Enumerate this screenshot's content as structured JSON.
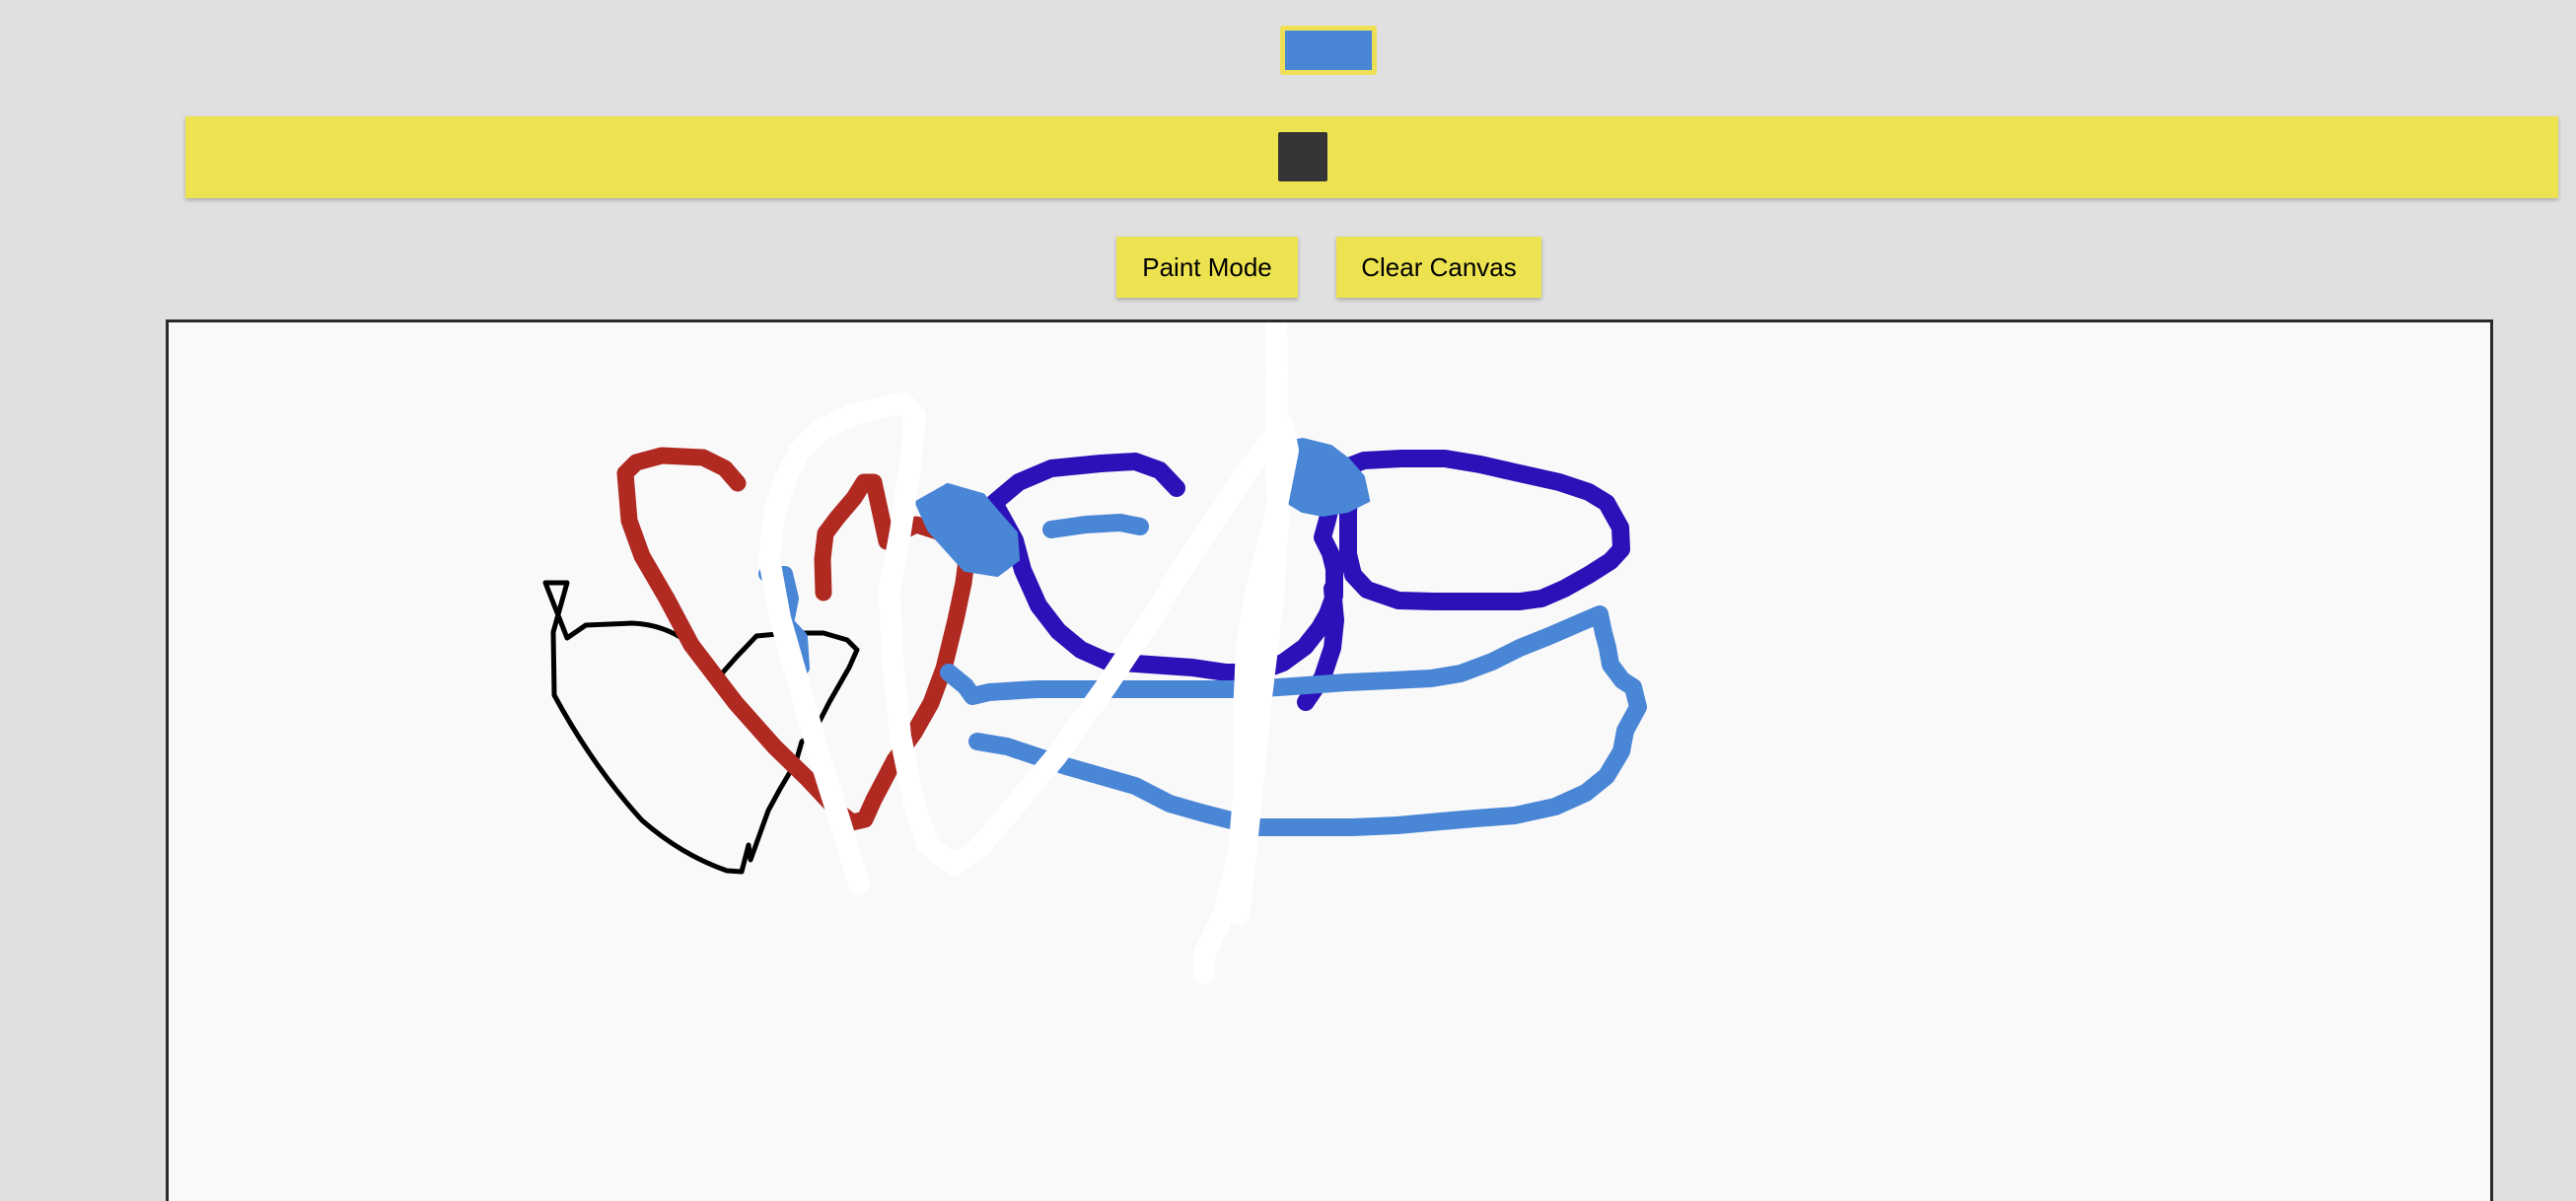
{
  "toolbar": {
    "current_color": "#4a86d6",
    "swatch_border_color": "#efdf55",
    "brush_size_bar_color": "#ede350",
    "brush_size_handle_color": "#343434"
  },
  "buttons": {
    "paint_mode_label": "Paint Mode",
    "clear_canvas_label": "Clear Canvas"
  },
  "canvas": {
    "background": "#f9f9f9",
    "stroke_colors": [
      "#000000",
      "#b02a22",
      "#2a12b8",
      "#4a86d6",
      "#ffffff"
    ]
  }
}
